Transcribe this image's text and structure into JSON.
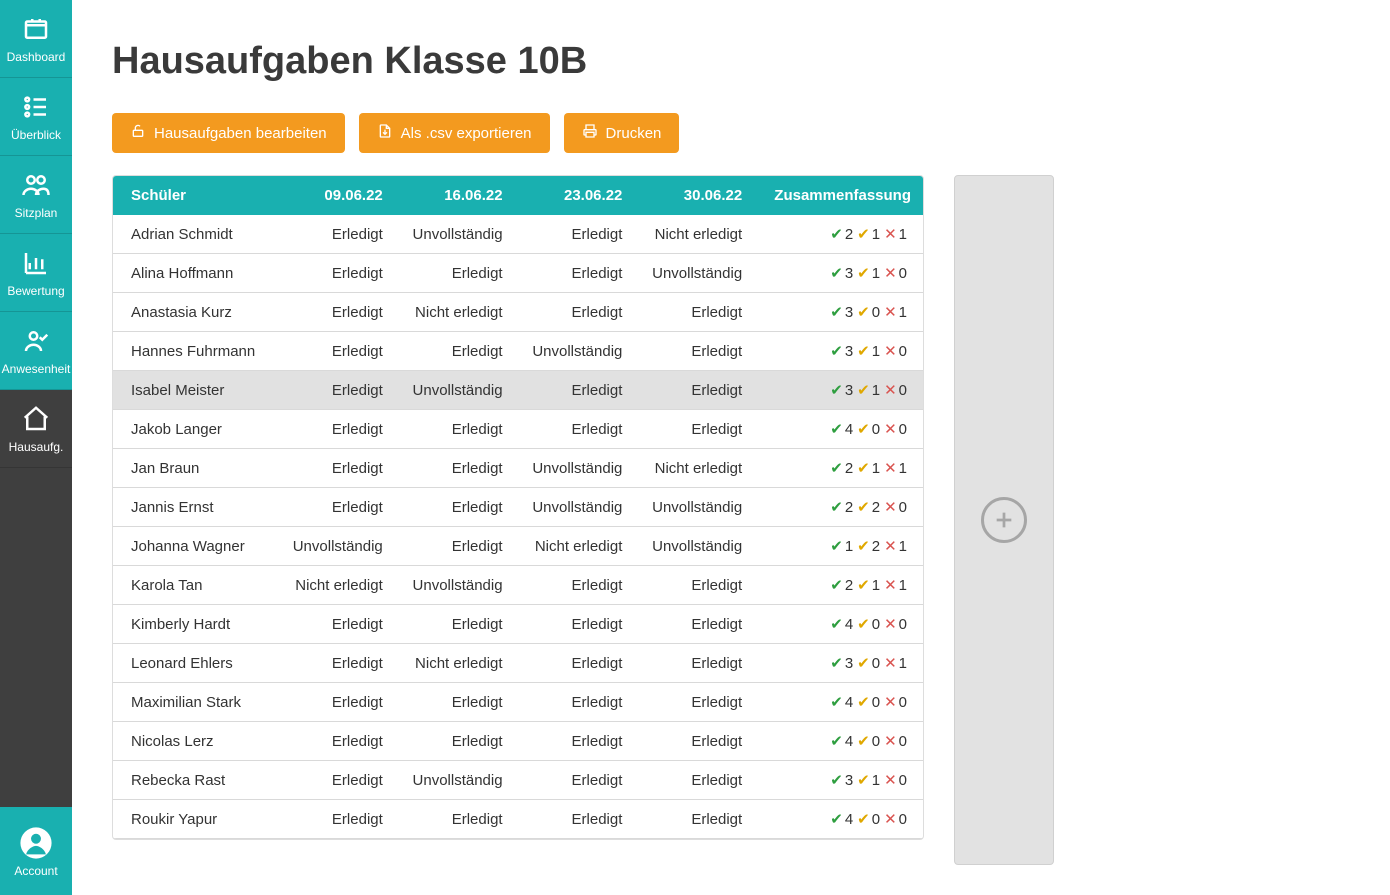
{
  "sidebar": {
    "items": [
      {
        "label": "Dashboard",
        "icon": "dashboard-icon"
      },
      {
        "label": "Überblick",
        "icon": "list-icon"
      },
      {
        "label": "Sitzplan",
        "icon": "people-icon"
      },
      {
        "label": "Bewertung",
        "icon": "chart-icon"
      },
      {
        "label": "Anwesenheit",
        "icon": "attendance-icon"
      },
      {
        "label": "Hausaufg.",
        "icon": "home-icon"
      }
    ],
    "account_label": "Account"
  },
  "page": {
    "title": "Hausaufgaben Klasse 10B"
  },
  "toolbar": {
    "edit_label": "Hausaufgaben bearbeiten",
    "export_label": "Als .csv exportieren",
    "print_label": "Drucken"
  },
  "table": {
    "columns": [
      "Schüler",
      "09.06.22",
      "16.06.22",
      "23.06.22",
      "30.06.22",
      "Zusammenfassung"
    ],
    "rows": [
      {
        "name": "Adrian Schmidt",
        "cells": [
          "Erledigt",
          "Unvollständig",
          "Erledigt",
          "Nicht erledigt"
        ],
        "sum": {
          "done": 2,
          "partial": 1,
          "missing": 1
        }
      },
      {
        "name": "Alina Hoffmann",
        "cells": [
          "Erledigt",
          "Erledigt",
          "Erledigt",
          "Unvollständig"
        ],
        "sum": {
          "done": 3,
          "partial": 1,
          "missing": 0
        }
      },
      {
        "name": "Anastasia Kurz",
        "cells": [
          "Erledigt",
          "Nicht erledigt",
          "Erledigt",
          "Erledigt"
        ],
        "sum": {
          "done": 3,
          "partial": 0,
          "missing": 1
        }
      },
      {
        "name": "Hannes Fuhrmann",
        "cells": [
          "Erledigt",
          "Erledigt",
          "Unvollständig",
          "Erledigt"
        ],
        "sum": {
          "done": 3,
          "partial": 1,
          "missing": 0
        }
      },
      {
        "name": "Isabel Meister",
        "cells": [
          "Erledigt",
          "Unvollständig",
          "Erledigt",
          "Erledigt"
        ],
        "sum": {
          "done": 3,
          "partial": 1,
          "missing": 0
        },
        "hover": true
      },
      {
        "name": "Jakob Langer",
        "cells": [
          "Erledigt",
          "Erledigt",
          "Erledigt",
          "Erledigt"
        ],
        "sum": {
          "done": 4,
          "partial": 0,
          "missing": 0
        }
      },
      {
        "name": "Jan Braun",
        "cells": [
          "Erledigt",
          "Erledigt",
          "Unvollständig",
          "Nicht erledigt"
        ],
        "sum": {
          "done": 2,
          "partial": 1,
          "missing": 1
        }
      },
      {
        "name": "Jannis Ernst",
        "cells": [
          "Erledigt",
          "Erledigt",
          "Unvollständig",
          "Unvollständig"
        ],
        "sum": {
          "done": 2,
          "partial": 2,
          "missing": 0
        }
      },
      {
        "name": "Johanna Wagner",
        "cells": [
          "Unvollständig",
          "Erledigt",
          "Nicht erledigt",
          "Unvollständig"
        ],
        "sum": {
          "done": 1,
          "partial": 2,
          "missing": 1
        }
      },
      {
        "name": "Karola Tan",
        "cells": [
          "Nicht erledigt",
          "Unvollständig",
          "Erledigt",
          "Erledigt"
        ],
        "sum": {
          "done": 2,
          "partial": 1,
          "missing": 1
        }
      },
      {
        "name": "Kimberly Hardt",
        "cells": [
          "Erledigt",
          "Erledigt",
          "Erledigt",
          "Erledigt"
        ],
        "sum": {
          "done": 4,
          "partial": 0,
          "missing": 0
        }
      },
      {
        "name": "Leonard Ehlers",
        "cells": [
          "Erledigt",
          "Nicht erledigt",
          "Erledigt",
          "Erledigt"
        ],
        "sum": {
          "done": 3,
          "partial": 0,
          "missing": 1
        }
      },
      {
        "name": "Maximilian Stark",
        "cells": [
          "Erledigt",
          "Erledigt",
          "Erledigt",
          "Erledigt"
        ],
        "sum": {
          "done": 4,
          "partial": 0,
          "missing": 0
        }
      },
      {
        "name": "Nicolas Lerz",
        "cells": [
          "Erledigt",
          "Erledigt",
          "Erledigt",
          "Erledigt"
        ],
        "sum": {
          "done": 4,
          "partial": 0,
          "missing": 0
        }
      },
      {
        "name": "Rebecka Rast",
        "cells": [
          "Erledigt",
          "Unvollständig",
          "Erledigt",
          "Erledigt"
        ],
        "sum": {
          "done": 3,
          "partial": 1,
          "missing": 0
        }
      },
      {
        "name": "Roukir Yapur",
        "cells": [
          "Erledigt",
          "Erledigt",
          "Erledigt",
          "Erledigt"
        ],
        "sum": {
          "done": 4,
          "partial": 0,
          "missing": 0
        }
      }
    ]
  }
}
